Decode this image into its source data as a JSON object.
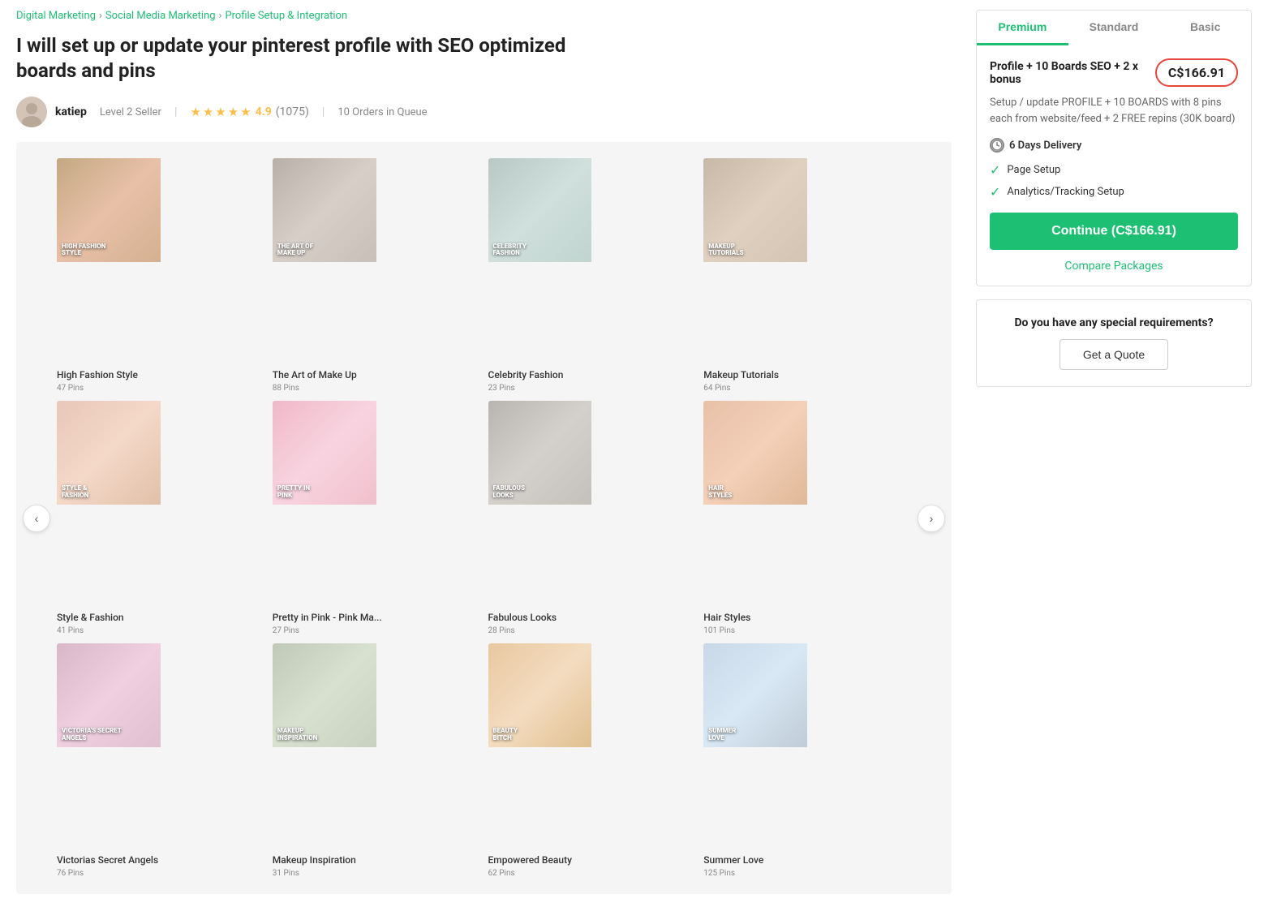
{
  "breadcrumb": {
    "items": [
      {
        "label": "Digital Marketing",
        "url": "#"
      },
      {
        "label": "Social Media Marketing",
        "url": "#"
      },
      {
        "label": "Profile Setup & Integration",
        "url": "#"
      }
    ]
  },
  "gig": {
    "title": "I will set up or update your pinterest profile with SEO optimized boards and pins",
    "seller": {
      "name": "katiep",
      "level": "Level 2 Seller",
      "rating": "4.9",
      "review_count": "(1075)",
      "orders_in_queue": "10 Orders in Queue"
    }
  },
  "gallery": {
    "items": [
      {
        "label": "High Fashion Style",
        "sublabel": "47 Pins",
        "overlay": "HIGH FASHION STYLE"
      },
      {
        "label": "The Art of Make Up",
        "sublabel": "88 Pins",
        "overlay": "THE ART OF MAKE UP"
      },
      {
        "label": "Celebrity Fashion",
        "sublabel": "23 Pins",
        "overlay": "CELEBRITY FASHION"
      },
      {
        "label": "Makeup Tutorials",
        "sublabel": "64 Pins",
        "overlay": "MAKEUP TUTORIALS"
      },
      {
        "label": "Style & Fashion",
        "sublabel": "41 Pins",
        "overlay": "STYLE & FASHION"
      },
      {
        "label": "Pretty in Pink - Pink Ma...",
        "sublabel": "27 Pins",
        "overlay": "PRETTY IN PINK"
      },
      {
        "label": "Fabulous Looks",
        "sublabel": "28 Pins",
        "overlay": "FABULOUS LOOKS"
      },
      {
        "label": "Hair Styles",
        "sublabel": "101 Pins",
        "overlay": "HAIR STYLES"
      },
      {
        "label": "Victorias Secret Angels",
        "sublabel": "76 Pins",
        "overlay": "VICTORIA'S SECRET ANGELS"
      },
      {
        "label": "Makeup Inspiration",
        "sublabel": "31 Pins",
        "overlay": "MAKEUP INSPIRATION"
      },
      {
        "label": "Empowered Beauty",
        "sublabel": "62 Pins",
        "overlay": "BEAUTY BITCH"
      },
      {
        "label": "Summer Love",
        "sublabel": "125 Pins",
        "overlay": "SUMMER LOVE"
      }
    ]
  },
  "packages": {
    "tabs": [
      "Premium",
      "Standard",
      "Basic"
    ],
    "active_tab": 0,
    "premium": {
      "name": "Profile + 10 Boards SEO + 2 x bonus",
      "price": "C$166.91",
      "description": "Setup / update PROFILE + 10 BOARDS with 8 pins each from website/feed + 2 FREE repins (30K board)",
      "delivery": "6 Days Delivery",
      "features": [
        "Page Setup",
        "Analytics/Tracking Setup"
      ],
      "cta_label": "Continue (C$166.91)"
    }
  },
  "compare_label": "Compare Packages",
  "special_requirements": {
    "title": "Do you have any special requirements?",
    "cta_label": "Get a Quote"
  },
  "nav": {
    "prev": "‹",
    "next": "›"
  }
}
